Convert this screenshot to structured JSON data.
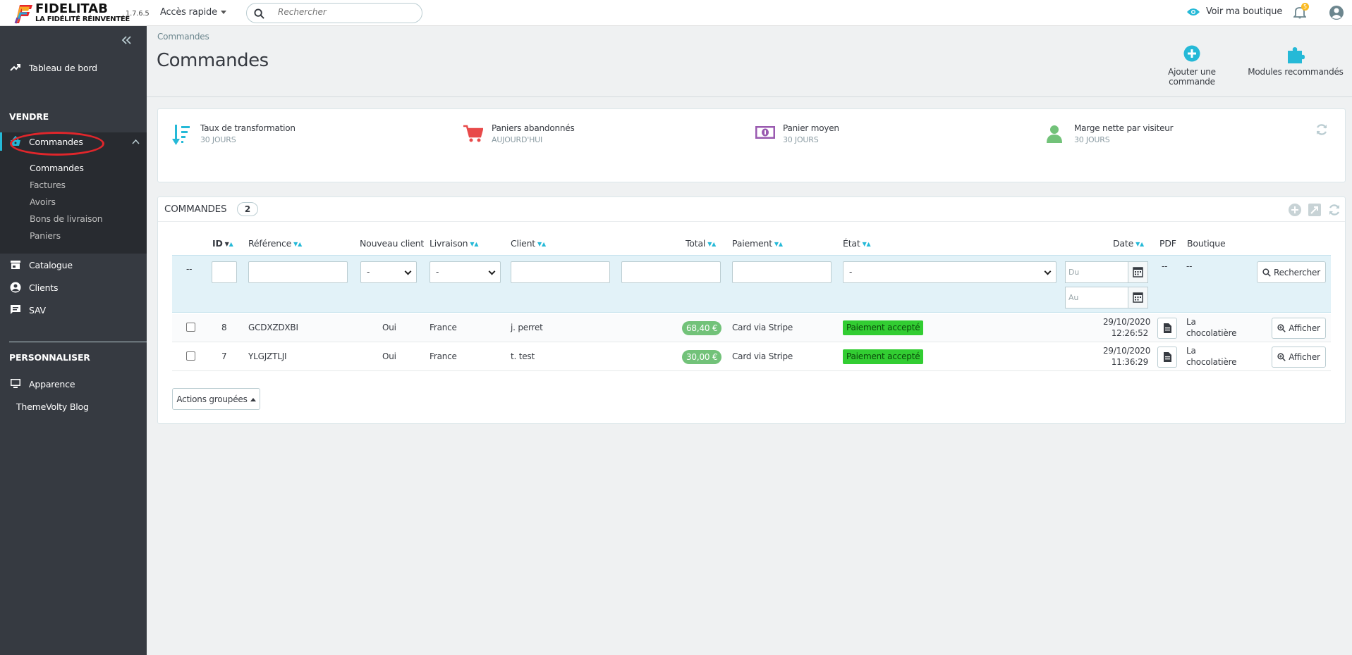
{
  "header": {
    "logo_name": "FIDELITAB",
    "logo_tagline": "LA FIDÉLITÉ RÉINVENTÉE",
    "version": "1.7.6.5",
    "quick_access": "Accès rapide",
    "search_placeholder": "Rechercher",
    "view_shop": "Voir ma boutique",
    "notification_count": "5"
  },
  "sidebar": {
    "dashboard": "Tableau de bord",
    "section_sell": "VENDRE",
    "orders": "Commandes",
    "orders_sub": [
      "Commandes",
      "Factures",
      "Avoirs",
      "Bons de livraison",
      "Paniers"
    ],
    "catalog": "Catalogue",
    "customers": "Clients",
    "sav": "SAV",
    "section_customize": "PERSONNALISER",
    "appearance": "Apparence",
    "themevolty": "ThemeVolty Blog"
  },
  "page": {
    "breadcrumb": "Commandes",
    "title": "Commandes",
    "add_order": "Ajouter une commande",
    "recommended_modules": "Modules recommandés"
  },
  "kpis": [
    {
      "title": "Taux de transformation",
      "sub": "30 JOURS",
      "color": "#25b9d7",
      "icon": "sort-amount-icon"
    },
    {
      "title": "Paniers abandonnés",
      "sub": "AUJOURD'HUI",
      "color": "#e84a4a",
      "icon": "cart-icon"
    },
    {
      "title": "Panier moyen",
      "sub": "30 JOURS",
      "color": "#9a5ab0",
      "icon": "money-icon"
    },
    {
      "title": "Marge nette par visiteur",
      "sub": "30 JOURS",
      "color": "#72c279",
      "icon": "user-icon"
    }
  ],
  "orders": {
    "title": "COMMANDES",
    "count": "2",
    "columns": {
      "id": "ID",
      "reference": "Référence",
      "new_client": "Nouveau client",
      "delivery": "Livraison",
      "client": "Client",
      "total": "Total",
      "payment": "Paiement",
      "state": "État",
      "date": "Date",
      "pdf": "PDF",
      "shop": "Boutique"
    },
    "filters": {
      "dash": "--",
      "select_default": "-",
      "date_from": "Du",
      "date_to": "Au",
      "search_button": "Rechercher"
    },
    "rows": [
      {
        "id": "8",
        "reference": "GCDXZDXBI",
        "new_client": "Oui",
        "delivery": "France",
        "client": "j. perret",
        "total": "68,40 €",
        "payment": "Card via Stripe",
        "state": "Paiement accepté",
        "date": "29/10/2020",
        "time": "12:26:52",
        "shop_1": "La",
        "shop_2": "chocolatière",
        "action": "Afficher"
      },
      {
        "id": "7",
        "reference": "YLGJZTLJI",
        "new_client": "Oui",
        "delivery": "France",
        "client": "t. test",
        "total": "30,00 €",
        "payment": "Card via Stripe",
        "state": "Paiement accepté",
        "date": "29/10/2020",
        "time": "11:36:29",
        "shop_1": "La",
        "shop_2": "chocolatière",
        "action": "Afficher"
      }
    ],
    "bulk_actions": "Actions groupées"
  },
  "colors": {
    "accent": "#25b9d7",
    "sidebar_bg": "#363a41",
    "status_accepted": "#32cd32",
    "price_badge": "#72c279",
    "annotation_oval": "#e0262b"
  }
}
